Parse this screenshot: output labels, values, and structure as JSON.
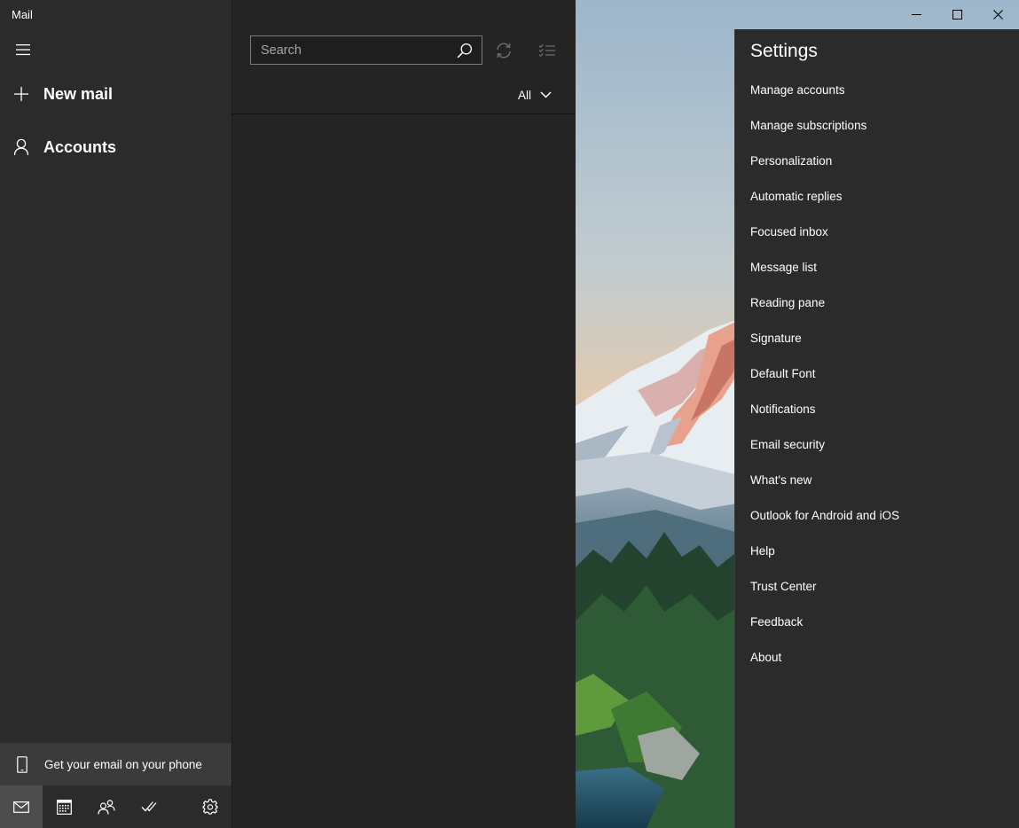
{
  "app": {
    "title": "Mail"
  },
  "nav": {
    "menu_icon": "hamburger-icon",
    "new_mail_label": "New mail",
    "accounts_label": "Accounts",
    "phone_banner_label": "Get your email on your phone"
  },
  "bottom_bar": {
    "items": [
      {
        "name": "mail",
        "icon": "mail-icon",
        "active": true
      },
      {
        "name": "calendar",
        "icon": "calendar-icon",
        "active": false
      },
      {
        "name": "people",
        "icon": "people-icon",
        "active": false
      },
      {
        "name": "todo",
        "icon": "checkmark-icon",
        "active": false
      },
      {
        "name": "settings",
        "icon": "gear-icon",
        "active": false
      }
    ]
  },
  "message_list": {
    "search_placeholder": "Search",
    "filter_label": "All"
  },
  "settings": {
    "title": "Settings",
    "items": [
      "Manage accounts",
      "Manage subscriptions",
      "Personalization",
      "Automatic replies",
      "Focused inbox",
      "Message list",
      "Reading pane",
      "Signature",
      "Default Font",
      "Notifications",
      "Email security",
      "What's new",
      "Outlook for Android and iOS",
      "Help",
      "Trust Center",
      "Feedback",
      "About"
    ]
  },
  "colors": {
    "nav_bg": "#2b2b2b",
    "list_bg": "#242424",
    "flyout_bg": "#2b2b2b",
    "active_tab_bg": "#4d4d4d",
    "banner_bg": "#3b3b3b"
  }
}
